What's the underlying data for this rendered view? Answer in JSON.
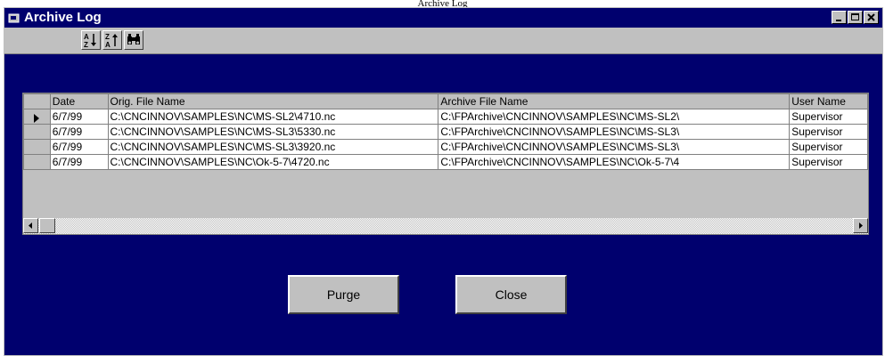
{
  "page": {
    "caption": "Archive Log"
  },
  "window": {
    "title": "Archive Log"
  },
  "toolbar": {
    "icons": [
      "sort-ascending-icon",
      "sort-descending-icon",
      "find-binoculars-icon"
    ]
  },
  "grid": {
    "columns": [
      "Date",
      "Orig. File Name",
      "Archive File Name",
      "User Name"
    ],
    "rows": [
      [
        "6/7/99",
        "C:\\CNCINNOV\\SAMPLES\\NC\\MS-SL2\\4710.nc",
        "C:\\FPArchive\\CNCINNOV\\SAMPLES\\NC\\MS-SL2\\",
        "Supervisor"
      ],
      [
        "6/7/99",
        "C:\\CNCINNOV\\SAMPLES\\NC\\MS-SL3\\5330.nc",
        "C:\\FPArchive\\CNCINNOV\\SAMPLES\\NC\\MS-SL3\\",
        "Supervisor"
      ],
      [
        "6/7/99",
        "C:\\CNCINNOV\\SAMPLES\\NC\\MS-SL3\\3920.nc",
        "C:\\FPArchive\\CNCINNOV\\SAMPLES\\NC\\MS-SL3\\",
        "Supervisor"
      ],
      [
        "6/7/99",
        "C:\\CNCINNOV\\SAMPLES\\NC\\Ok-5-7\\4720.nc",
        "C:\\FPArchive\\CNCINNOV\\SAMPLES\\NC\\Ok-5-7\\4",
        "Supervisor"
      ]
    ],
    "current_row": 0
  },
  "buttons": {
    "purge": "Purge",
    "close": "Close"
  },
  "colors": {
    "window_bg": "#00006e",
    "face": "#c0c0c0"
  }
}
